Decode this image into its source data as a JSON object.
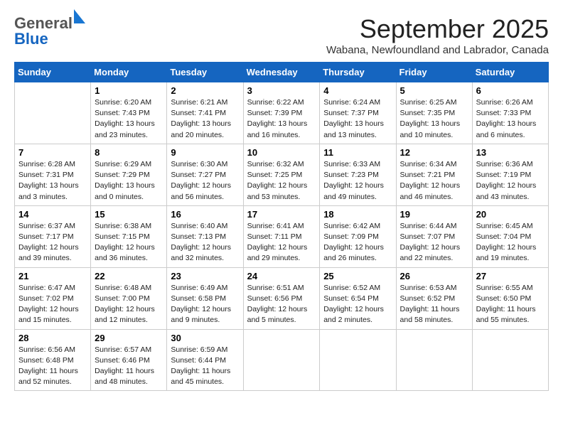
{
  "header": {
    "logo_general": "General",
    "logo_blue": "Blue",
    "month": "September 2025",
    "subtitle": "Wabana, Newfoundland and Labrador, Canada"
  },
  "days": [
    "Sunday",
    "Monday",
    "Tuesday",
    "Wednesday",
    "Thursday",
    "Friday",
    "Saturday"
  ],
  "weeks": [
    [
      {
        "day": "",
        "info": ""
      },
      {
        "day": "1",
        "info": "Sunrise: 6:20 AM\nSunset: 7:43 PM\nDaylight: 13 hours\nand 23 minutes."
      },
      {
        "day": "2",
        "info": "Sunrise: 6:21 AM\nSunset: 7:41 PM\nDaylight: 13 hours\nand 20 minutes."
      },
      {
        "day": "3",
        "info": "Sunrise: 6:22 AM\nSunset: 7:39 PM\nDaylight: 13 hours\nand 16 minutes."
      },
      {
        "day": "4",
        "info": "Sunrise: 6:24 AM\nSunset: 7:37 PM\nDaylight: 13 hours\nand 13 minutes."
      },
      {
        "day": "5",
        "info": "Sunrise: 6:25 AM\nSunset: 7:35 PM\nDaylight: 13 hours\nand 10 minutes."
      },
      {
        "day": "6",
        "info": "Sunrise: 6:26 AM\nSunset: 7:33 PM\nDaylight: 13 hours\nand 6 minutes."
      }
    ],
    [
      {
        "day": "7",
        "info": "Sunrise: 6:28 AM\nSunset: 7:31 PM\nDaylight: 13 hours\nand 3 minutes."
      },
      {
        "day": "8",
        "info": "Sunrise: 6:29 AM\nSunset: 7:29 PM\nDaylight: 13 hours\nand 0 minutes."
      },
      {
        "day": "9",
        "info": "Sunrise: 6:30 AM\nSunset: 7:27 PM\nDaylight: 12 hours\nand 56 minutes."
      },
      {
        "day": "10",
        "info": "Sunrise: 6:32 AM\nSunset: 7:25 PM\nDaylight: 12 hours\nand 53 minutes."
      },
      {
        "day": "11",
        "info": "Sunrise: 6:33 AM\nSunset: 7:23 PM\nDaylight: 12 hours\nand 49 minutes."
      },
      {
        "day": "12",
        "info": "Sunrise: 6:34 AM\nSunset: 7:21 PM\nDaylight: 12 hours\nand 46 minutes."
      },
      {
        "day": "13",
        "info": "Sunrise: 6:36 AM\nSunset: 7:19 PM\nDaylight: 12 hours\nand 43 minutes."
      }
    ],
    [
      {
        "day": "14",
        "info": "Sunrise: 6:37 AM\nSunset: 7:17 PM\nDaylight: 12 hours\nand 39 minutes."
      },
      {
        "day": "15",
        "info": "Sunrise: 6:38 AM\nSunset: 7:15 PM\nDaylight: 12 hours\nand 36 minutes."
      },
      {
        "day": "16",
        "info": "Sunrise: 6:40 AM\nSunset: 7:13 PM\nDaylight: 12 hours\nand 32 minutes."
      },
      {
        "day": "17",
        "info": "Sunrise: 6:41 AM\nSunset: 7:11 PM\nDaylight: 12 hours\nand 29 minutes."
      },
      {
        "day": "18",
        "info": "Sunrise: 6:42 AM\nSunset: 7:09 PM\nDaylight: 12 hours\nand 26 minutes."
      },
      {
        "day": "19",
        "info": "Sunrise: 6:44 AM\nSunset: 7:07 PM\nDaylight: 12 hours\nand 22 minutes."
      },
      {
        "day": "20",
        "info": "Sunrise: 6:45 AM\nSunset: 7:04 PM\nDaylight: 12 hours\nand 19 minutes."
      }
    ],
    [
      {
        "day": "21",
        "info": "Sunrise: 6:47 AM\nSunset: 7:02 PM\nDaylight: 12 hours\nand 15 minutes."
      },
      {
        "day": "22",
        "info": "Sunrise: 6:48 AM\nSunset: 7:00 PM\nDaylight: 12 hours\nand 12 minutes."
      },
      {
        "day": "23",
        "info": "Sunrise: 6:49 AM\nSunset: 6:58 PM\nDaylight: 12 hours\nand 9 minutes."
      },
      {
        "day": "24",
        "info": "Sunrise: 6:51 AM\nSunset: 6:56 PM\nDaylight: 12 hours\nand 5 minutes."
      },
      {
        "day": "25",
        "info": "Sunrise: 6:52 AM\nSunset: 6:54 PM\nDaylight: 12 hours\nand 2 minutes."
      },
      {
        "day": "26",
        "info": "Sunrise: 6:53 AM\nSunset: 6:52 PM\nDaylight: 11 hours\nand 58 minutes."
      },
      {
        "day": "27",
        "info": "Sunrise: 6:55 AM\nSunset: 6:50 PM\nDaylight: 11 hours\nand 55 minutes."
      }
    ],
    [
      {
        "day": "28",
        "info": "Sunrise: 6:56 AM\nSunset: 6:48 PM\nDaylight: 11 hours\nand 52 minutes."
      },
      {
        "day": "29",
        "info": "Sunrise: 6:57 AM\nSunset: 6:46 PM\nDaylight: 11 hours\nand 48 minutes."
      },
      {
        "day": "30",
        "info": "Sunrise: 6:59 AM\nSunset: 6:44 PM\nDaylight: 11 hours\nand 45 minutes."
      },
      {
        "day": "",
        "info": ""
      },
      {
        "day": "",
        "info": ""
      },
      {
        "day": "",
        "info": ""
      },
      {
        "day": "",
        "info": ""
      }
    ]
  ]
}
